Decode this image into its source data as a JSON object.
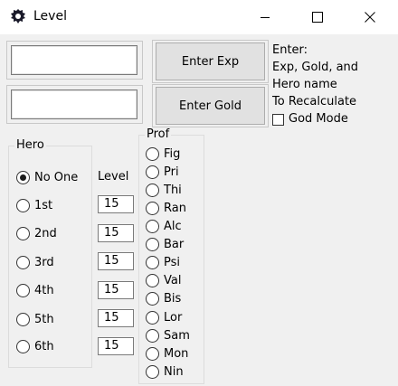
{
  "window": {
    "title": "Level",
    "icon": "gear-app-icon",
    "controls": [
      "minimize-icon",
      "maximize-icon",
      "close-icon"
    ]
  },
  "inputs": {
    "exp_value": "",
    "gold_value": ""
  },
  "buttons": {
    "enter_exp": "Enter Exp",
    "enter_gold": "Enter Gold"
  },
  "info": {
    "line1": "Enter:",
    "line2": "Exp, Gold, and",
    "line3": "Hero name",
    "line4": "To Recalculate"
  },
  "god_mode": {
    "label": "God Mode",
    "checked": false
  },
  "hero": {
    "legend": "Hero",
    "options": [
      "No One",
      "1st",
      "2nd",
      "3rd",
      "4th",
      "5th",
      "6th"
    ],
    "selected": "No One"
  },
  "level": {
    "label": "Level",
    "values": [
      "15",
      "15",
      "15",
      "15",
      "15",
      "15"
    ]
  },
  "prof": {
    "legend": "Prof",
    "options": [
      "Fig",
      "Pri",
      "Thi",
      "Ran",
      "Alc",
      "Bar",
      "Psi",
      "Val",
      "Bis",
      "Lor",
      "Sam",
      "Mon",
      "Nin"
    ]
  }
}
